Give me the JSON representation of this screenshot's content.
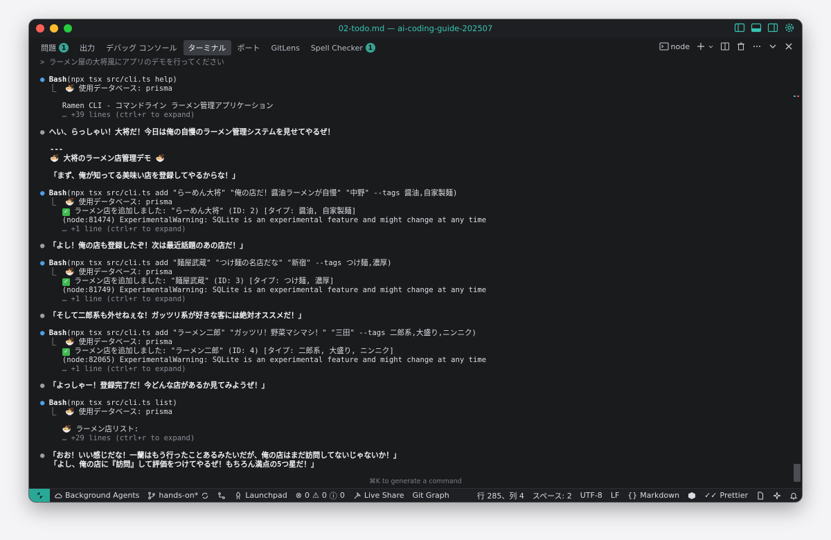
{
  "window": {
    "title": "02-todo.md — ai-coding-guide-202507"
  },
  "panel": {
    "tabs": [
      {
        "label": "問題",
        "badge": "1"
      },
      {
        "label": "出力"
      },
      {
        "label": "デバッグ コンソール"
      },
      {
        "label": "ターミナル",
        "active": true
      },
      {
        "label": "ポート"
      },
      {
        "label": "GitLens"
      },
      {
        "label": "Spell Checker",
        "badge": "1"
      }
    ],
    "terminal_name": "node"
  },
  "terminal": {
    "prompt": "> ラーメン屋の大将風にアプリのデモを行ってください",
    "b1_cmd": "Bash",
    "b1_args": "(npx tsx src/cli.ts help)",
    "b1_db": "  ⎿  🍜 使用データベース: prisma",
    "b1_out": "     Ramen CLI - コマンドライン ラーメン管理アプリケーション",
    "b1_more": "     … +39 lines (ctrl+r to expand)",
    "say1": "へい、らっしゃい！大将だ！今日は俺の自慢のラーメン管理システムを見せてやるぜ！",
    "rule": "---",
    "heading": "🍜 大将のラーメン店管理デモ 🍜",
    "say2": "「まず、俺が知ってる美味い店を登録してやるからな！」",
    "b2_cmd": "Bash",
    "b2_args": "(npx tsx src/cli.ts add \"らーめん大将\" \"俺の店だ！醤油ラーメンが自慢\" \"中野\" --tags 醤油,自家製麺)",
    "b2_db": "  ⎿  🍜 使用データベース: prisma",
    "b2_ok": "ラーメン店を追加しました: \"らーめん大将\" (ID: 2) [タイプ: 醤油, 自家製麺]",
    "b2_warn": "     (node:81474) ExperimentalWarning: SQLite is an experimental feature and might change at any time",
    "b2_more": "     … +1 line (ctrl+r to expand)",
    "say3": "「よし！俺の店も登録したぞ！次は最近話題のあの店だ！」",
    "b3_cmd": "Bash",
    "b3_args": "(npx tsx src/cli.ts add \"麺屋武蔵\" \"つけ麺の名店だな\" \"新宿\" --tags つけ麺,濃厚)",
    "b3_db": "  ⎿  🍜 使用データベース: prisma",
    "b3_ok": "ラーメン店を追加しました: \"麺屋武蔵\" (ID: 3) [タイプ: つけ麺, 濃厚]",
    "b3_warn": "     (node:81749) ExperimentalWarning: SQLite is an experimental feature and might change at any time",
    "b3_more": "     … +1 line (ctrl+r to expand)",
    "say4": "「そして二郎系も外せねぇな！ガッツリ系が好きな客には絶対オススメだ！」",
    "b4_cmd": "Bash",
    "b4_args": "(npx tsx src/cli.ts add \"ラーメン二郎\" \"ガッツリ！野菜マシマシ！\" \"三田\" --tags 二郎系,大盛り,ニンニク)",
    "b4_db": "  ⎿  🍜 使用データベース: prisma",
    "b4_ok": "ラーメン店を追加しました: \"ラーメン二郎\" (ID: 4) [タイプ: 二郎系, 大盛り, ニンニク]",
    "b4_warn": "     (node:82065) ExperimentalWarning: SQLite is an experimental feature and might change at any time",
    "b4_more": "     … +1 line (ctrl+r to expand)",
    "say5": "「よっしゃー！登録完了だ！今どんな店があるか見てみようぜ！」",
    "b5_cmd": "Bash",
    "b5_args": "(npx tsx src/cli.ts list)",
    "b5_db": "  ⎿  🍜 使用データベース: prisma",
    "b5_out": "     🍜 ラーメン店リスト:",
    "b5_more": "     … +29 lines (ctrl+r to expand)",
    "say6a": "「おお！いい感じだな！一蘭はもう行ったことあるみたいだが、俺の店はまだ訪問してないじゃないか！」",
    "say6b": "「よし、俺の店に『訪問』して評価をつけてやるぜ！もちろん満点の5つ星だ！」",
    "hint": "⌘K to generate a command"
  },
  "statusbar": {
    "agents": "Background Agents",
    "branch": "hands-on*",
    "launchpad": "Launchpad",
    "err": "0",
    "warn": "0",
    "info": "0",
    "liveshare": "Live Share",
    "gitgraph": "Git Graph",
    "position": "行 285、列 4",
    "spaces": "スペース: 2",
    "encoding": "UTF-8",
    "eol": "LF",
    "language": "Markdown",
    "prettier": "Prettier"
  },
  "colors": {
    "accent": "#37c4b1",
    "remote_bg": "#2aa897",
    "bullet": "#4ea0e6",
    "check": "#3fb950"
  }
}
